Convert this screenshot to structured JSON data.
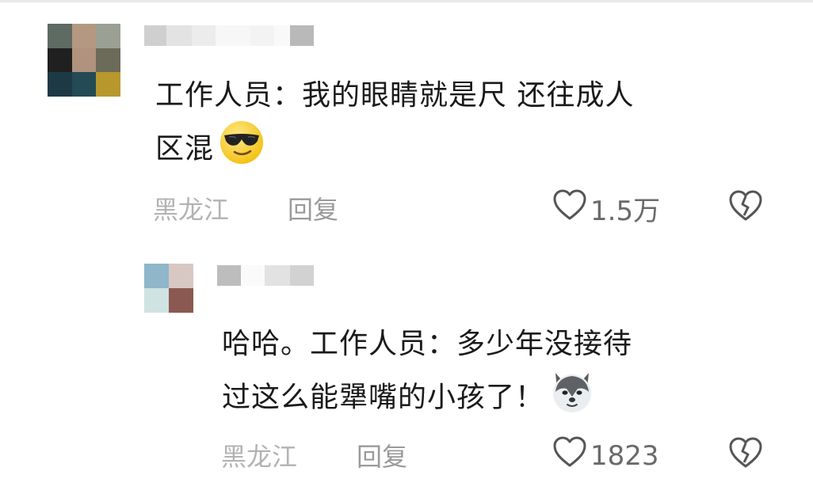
{
  "comments": [
    {
      "text_line1": "工作人员：我的眼睛就是尺  还往成人",
      "text_line2": "区混",
      "emoji": "sunglasses-face-emoji",
      "location": "黑龙江",
      "reply_label": "回复",
      "like_count": "1.5万"
    },
    {
      "text_line1": "哈哈。工作人员：多少年没接待",
      "text_line2": "过这么能犟嘴的小孩了！",
      "emoji": "husky-dog-emoji",
      "location": "黑龙江",
      "reply_label": "回复",
      "like_count": "1823"
    }
  ],
  "icons": {
    "like": "heart-outline-icon",
    "dislike": "broken-heart-icon"
  },
  "colors": {
    "text": "#1a1a1a",
    "meta": "#b3b3b3",
    "reply": "#9a9a9a",
    "count": "#6a6a6a"
  }
}
